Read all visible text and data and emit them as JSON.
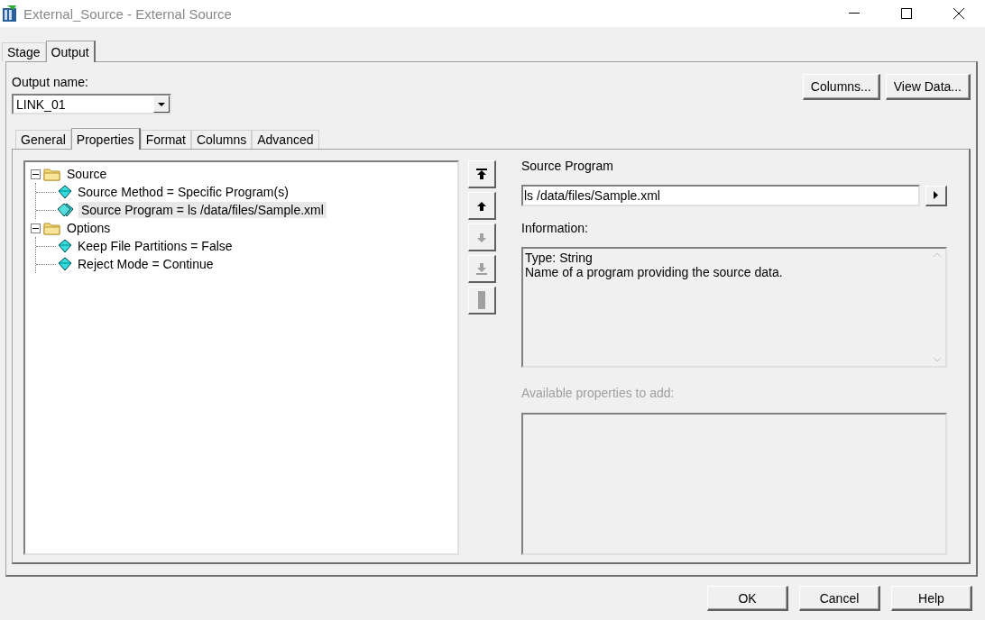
{
  "window": {
    "title": "External_Source - External Source"
  },
  "stage_tabs": [
    {
      "label": "Stage",
      "selected": false
    },
    {
      "label": "Output",
      "selected": true
    }
  ],
  "output_name": {
    "label": "Output name:",
    "value": "LINK_01"
  },
  "header_buttons": [
    "Columns...",
    "View Data..."
  ],
  "property_tabs": [
    {
      "label": "General",
      "selected": false
    },
    {
      "label": "Properties",
      "selected": true
    },
    {
      "label": "Format",
      "selected": false
    },
    {
      "label": "Columns",
      "selected": false
    },
    {
      "label": "Advanced",
      "selected": false
    }
  ],
  "property_tree": [
    {
      "kind": "folder",
      "label": "Source",
      "expanded": true,
      "selected": false,
      "children": [
        {
          "kind": "property",
          "label": "Source Method = Specific Program(s)",
          "selected": false
        },
        {
          "kind": "multi-property",
          "label": "Source Program = ls /data/files/Sample.xml",
          "selected": true
        }
      ]
    },
    {
      "kind": "folder",
      "label": "Options",
      "expanded": true,
      "selected": false,
      "children": [
        {
          "kind": "property",
          "label": "Keep File Partitions = False",
          "selected": false
        },
        {
          "kind": "property",
          "label": "Reject Mode = Continue",
          "selected": false
        }
      ]
    }
  ],
  "move_buttons": [
    {
      "kind": "top",
      "disabled": false
    },
    {
      "kind": "up",
      "disabled": false
    },
    {
      "kind": "down",
      "disabled": true
    },
    {
      "kind": "bottom",
      "disabled": true
    },
    {
      "kind": "bar",
      "disabled": true
    }
  ],
  "editor": {
    "label": "Source Program",
    "value": "ls /data/files/Sample.xml"
  },
  "information": {
    "label": "Information:",
    "lines": [
      "Type: String",
      "Name of a program providing the source data."
    ]
  },
  "available": {
    "label": "Available properties to add:",
    "disabled": true
  },
  "dialog_buttons": [
    "OK",
    "Cancel",
    "Help"
  ]
}
